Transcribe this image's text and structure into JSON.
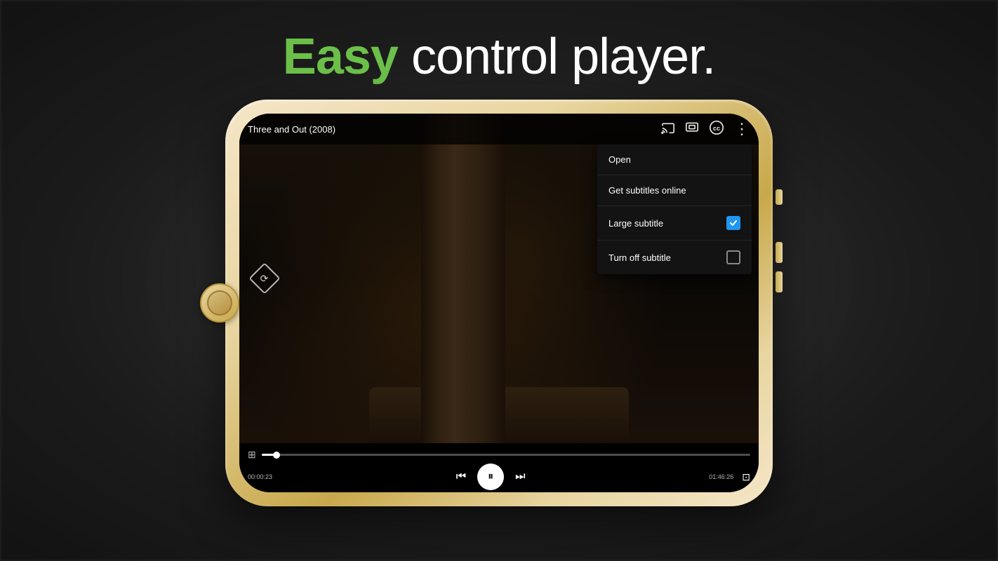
{
  "page": {
    "bg_color": "#444"
  },
  "hero": {
    "easy_label": "Easy",
    "rest_label": " control player."
  },
  "phone": {
    "player": {
      "title": "Three and Out (2008)",
      "icons": {
        "cast": "⇗",
        "screen_mirror": "⊡",
        "cc": "ⓒ",
        "more": "⋮"
      },
      "menu": {
        "items": [
          {
            "label": "Open",
            "has_checkbox": false,
            "checked": false
          },
          {
            "label": "Get subtitles online",
            "has_checkbox": false,
            "checked": false
          },
          {
            "label": "Large subtitle",
            "has_checkbox": true,
            "checked": true
          },
          {
            "label": "Turn off subtitle",
            "has_checkbox": true,
            "checked": false
          }
        ]
      },
      "controls": {
        "time_current": "00:00:23",
        "time_total": "01:46:26",
        "progress_pct": 3
      }
    }
  }
}
